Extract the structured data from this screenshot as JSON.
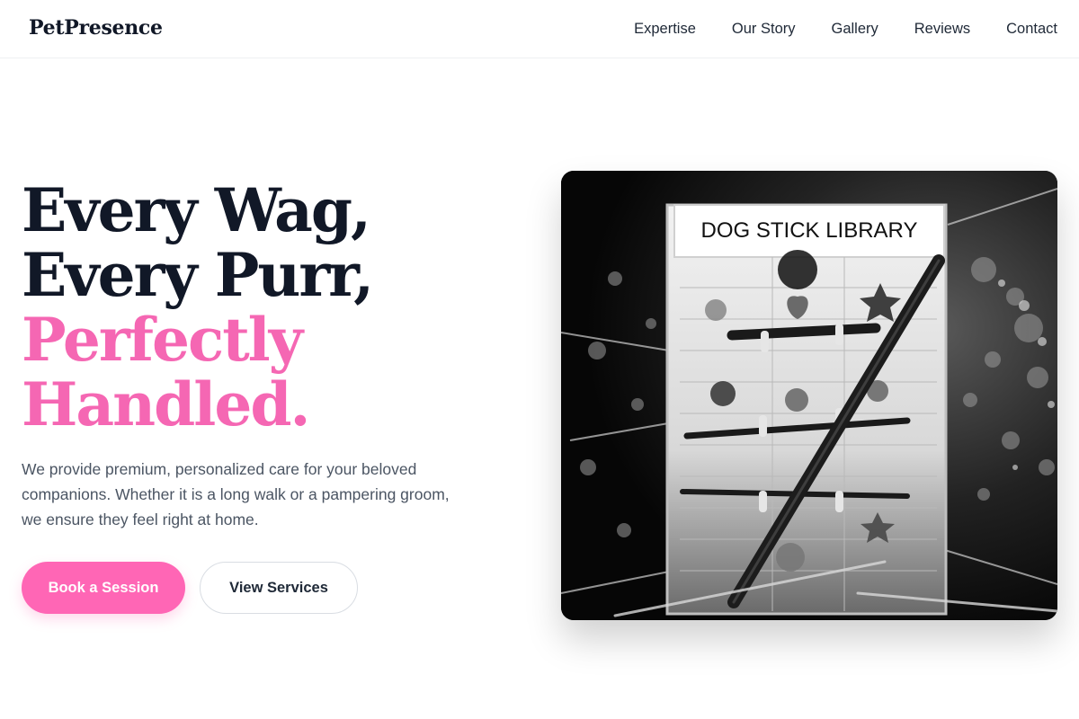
{
  "brand": {
    "name": "PetPresence"
  },
  "nav": {
    "items": [
      {
        "label": "Expertise"
      },
      {
        "label": "Our Story"
      },
      {
        "label": "Gallery"
      },
      {
        "label": "Reviews"
      },
      {
        "label": "Contact"
      }
    ]
  },
  "hero": {
    "headline": {
      "line1": "Every Wag,",
      "line2": "Every Purr,",
      "line3": "Perfectly",
      "line4": "Handled."
    },
    "description": "We provide premium, personalized care for your beloved companions. Whether it is a long walk or a pampering groom, we ensure they feel right at home.",
    "primary_cta": "Book a Session",
    "secondary_cta": "View Services",
    "photo": {
      "sign_text": "DOG STICK LIBRARY"
    }
  },
  "colors": {
    "accent": "#ff66b5",
    "headline_accent": "#f567b3",
    "text_dark": "#111827",
    "text_muted": "#4b5563"
  }
}
